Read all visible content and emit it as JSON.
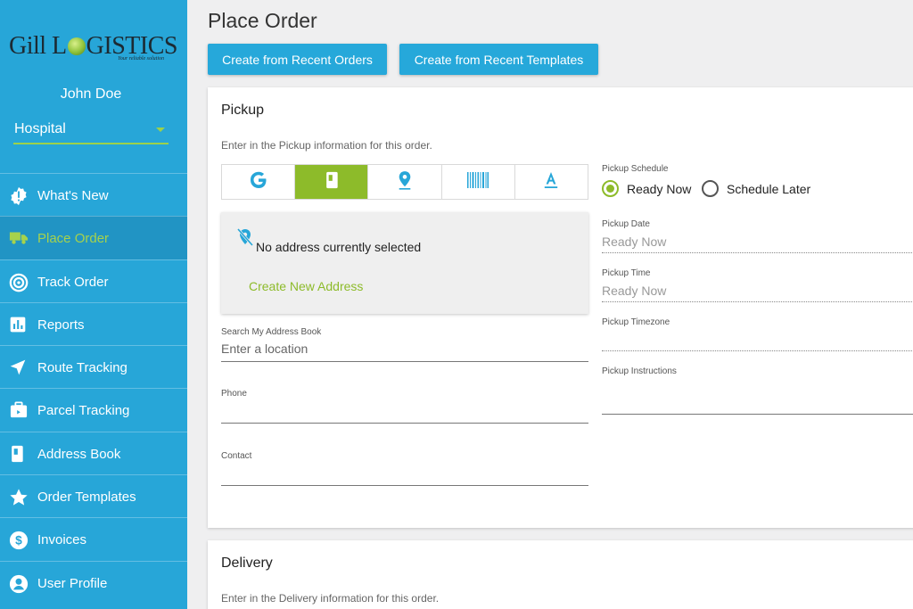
{
  "brand": {
    "logo_part1": "Gill L",
    "logo_part2": "GISTICS",
    "tagline": "Your reliable solution"
  },
  "user": {
    "name": "John Doe",
    "organization": "Hospital"
  },
  "nav": {
    "items": [
      {
        "label": "What's New",
        "icon": "badge-icon"
      },
      {
        "label": "Place Order",
        "icon": "truck-icon",
        "active": true
      },
      {
        "label": "Track Order",
        "icon": "target-icon"
      },
      {
        "label": "Reports",
        "icon": "bar-chart-icon"
      },
      {
        "label": "Route Tracking",
        "icon": "navigation-arrow-icon"
      },
      {
        "label": "Parcel Tracking",
        "icon": "briefcase-icon"
      },
      {
        "label": "Address Book",
        "icon": "book-icon"
      },
      {
        "label": "Order Templates",
        "icon": "star-icon"
      },
      {
        "label": "Invoices",
        "icon": "dollar-icon"
      },
      {
        "label": "User Profile",
        "icon": "user-icon"
      }
    ]
  },
  "page": {
    "title": "Place Order",
    "btn_recent_orders": "Create from Recent Orders",
    "btn_recent_templates": "Create from Recent Templates"
  },
  "pickup": {
    "title": "Pickup",
    "subtitle": "Enter in the Pickup information for this order.",
    "tabs": [
      "google-icon",
      "address-book-icon",
      "location-pin-icon",
      "barcode-icon",
      "text-entry-icon"
    ],
    "no_address": "No address currently selected",
    "create_address": "Create New Address",
    "search_label": "Search My Address Book",
    "search_placeholder": "Enter a location",
    "phone_label": "Phone",
    "contact_label": "Contact",
    "schedule_label": "Pickup Schedule",
    "ready_now": "Ready Now",
    "schedule_later": "Schedule Later",
    "date_label": "Pickup Date",
    "date_value": "Ready Now",
    "time_label": "Pickup Time",
    "time_value": "Ready Now",
    "timezone_label": "Pickup Timezone",
    "instructions_label": "Pickup Instructions"
  },
  "delivery": {
    "title": "Delivery",
    "subtitle": "Enter in the Delivery information for this order."
  },
  "colors": {
    "sidebar": "#27a6d8",
    "accent_green": "#8dbb2a",
    "button_blue": "#26a8da"
  }
}
